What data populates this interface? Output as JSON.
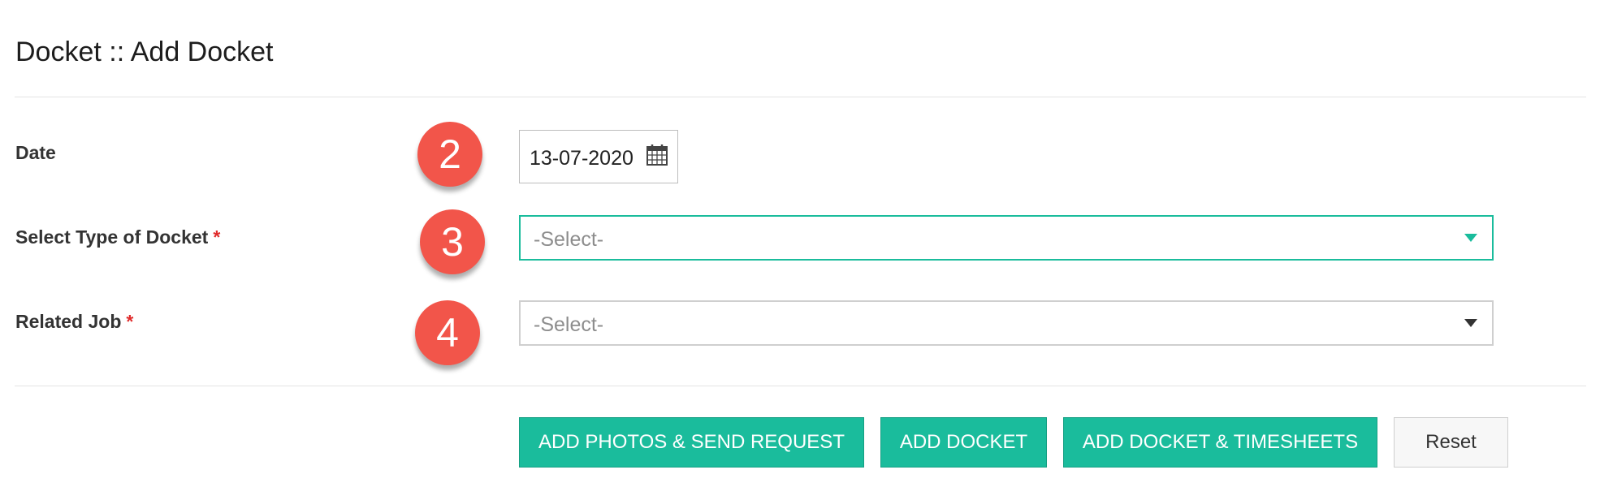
{
  "page": {
    "title": "Docket :: Add Docket"
  },
  "form": {
    "date": {
      "label": "Date",
      "value": "13-07-2020",
      "badge": "2"
    },
    "docket_type": {
      "label": "Select Type of Docket",
      "required_mark": "*",
      "placeholder": "-Select-",
      "badge": "3"
    },
    "related_job": {
      "label": "Related Job",
      "required_mark": "*",
      "placeholder": "-Select-",
      "badge": "4"
    }
  },
  "actions": {
    "add_photos_send_request": "ADD PHOTOS & SEND REQUEST",
    "add_docket": "ADD DOCKET",
    "add_docket_timesheets": "ADD DOCKET & TIMESHEETS",
    "reset": "Reset"
  },
  "colors": {
    "accent": "#1abc9c",
    "badge": "#f2554a",
    "required": "#e02b2b"
  },
  "icons": {
    "date": "calendar-icon",
    "dropdown": "caret-down-icon"
  }
}
